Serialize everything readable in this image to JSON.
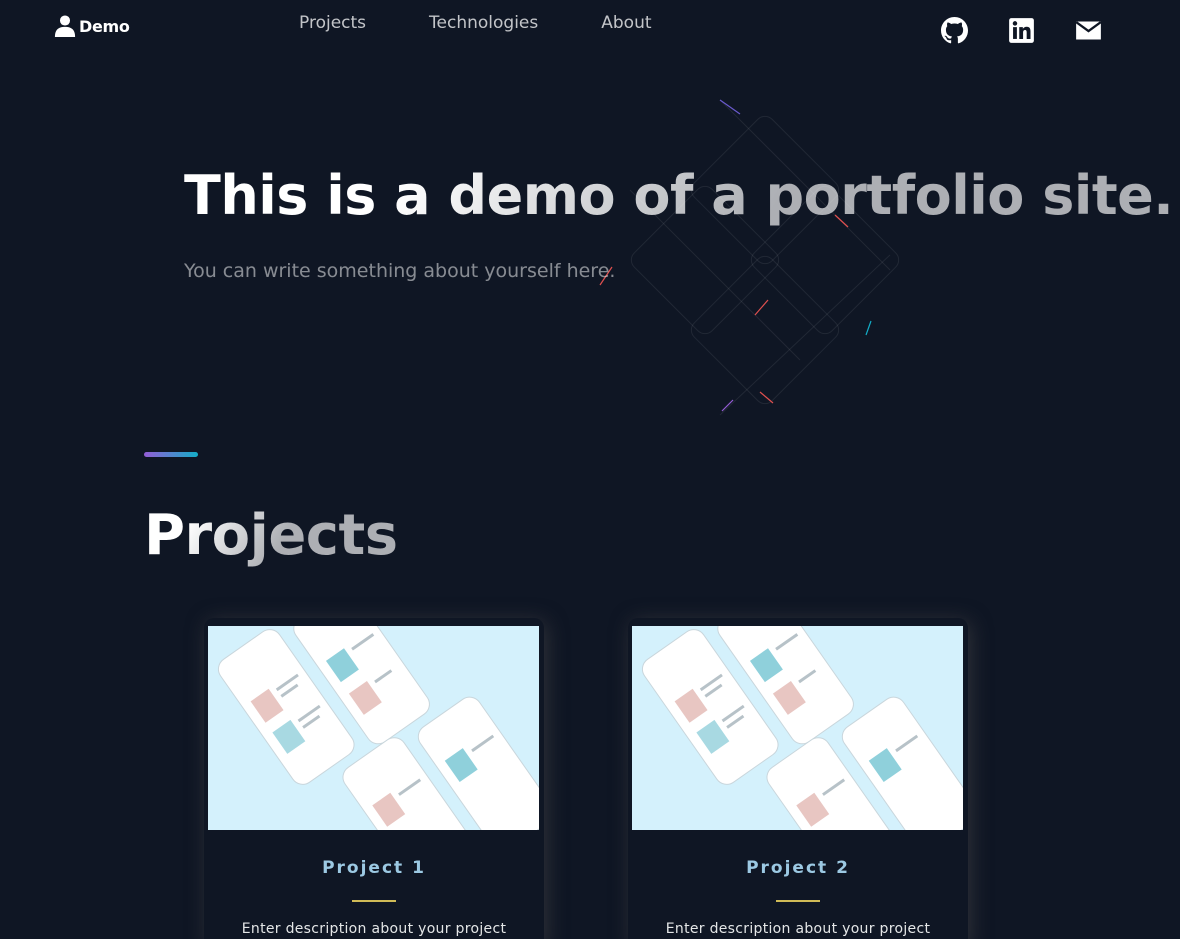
{
  "header": {
    "brand": "Demo",
    "nav": [
      "Projects",
      "Technologies",
      "About"
    ],
    "social_icons": [
      "github-icon",
      "linkedin-icon",
      "email-icon"
    ]
  },
  "hero": {
    "title": "This is a demo of a portfolio site.",
    "subtitle": "You can write something about yourself here."
  },
  "projects": {
    "heading": "Projects",
    "cards": [
      {
        "title": "Project 1",
        "description": "Enter description about your project"
      },
      {
        "title": "Project 2",
        "description": "Enter description about your project"
      }
    ]
  },
  "colors": {
    "background": "#0f1624",
    "accent_gradient_start": "#945dd6",
    "accent_gradient_end": "#13adc7",
    "card_title": "#9cc9e3",
    "card_rule": "#d0bb57",
    "card_image_bg": "#d4f1fc"
  }
}
